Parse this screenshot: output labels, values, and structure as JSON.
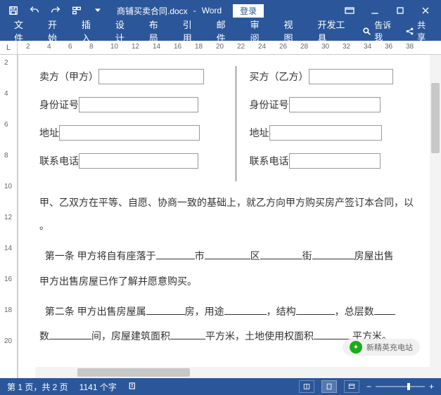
{
  "titlebar": {
    "filename": "商铺买卖合同.docx",
    "sep": "-",
    "app": "Word",
    "login": "登录"
  },
  "ribbon": {
    "tabs": [
      "文件",
      "开始",
      "插入",
      "设计",
      "布局",
      "引用",
      "邮件",
      "审阅",
      "视图",
      "开发工具"
    ],
    "tellme": "告诉我",
    "share": "共享"
  },
  "ruler": {
    "corner": "L",
    "hticks": [
      "2",
      "4",
      "6",
      "8",
      "10",
      "12",
      "14",
      "16",
      "18",
      "20",
      "22",
      "24",
      "26",
      "28",
      "30",
      "32",
      "34",
      "36",
      "38"
    ],
    "vticks": [
      "2",
      "4",
      "6",
      "8",
      "10",
      "12",
      "14",
      "16",
      "18",
      "20"
    ]
  },
  "doc": {
    "seller_title": "卖方（甲方）",
    "buyer_title": "买方（乙方）",
    "id_label": "身份证号",
    "addr_label": "地址",
    "phone_label": "联系电话",
    "para1": "甲、乙双方在平等、自愿、协商一致的基础上，就乙方向甲方购买房产签订本合同，以",
    "para1_cont": "。",
    "art1_head": "第一条",
    "art1_a": "甲方将自有座落于",
    "art1_b": "市",
    "art1_c": "区",
    "art1_d": "街",
    "art1_e": "房屋出售",
    "art1_2": "甲方出售房屋已作了解并愿意购买。",
    "art2_head": "第二条",
    "art2_a": "甲方出售房屋属",
    "art2_b": "房，用途",
    "art2_c": "，结构",
    "art2_d": "，总层数",
    "art2_e": "数",
    "art2_f": "间，房屋建筑面积",
    "art2_g": "平方米，土地使用权面积",
    "art2_h": "平方米。"
  },
  "status": {
    "page": "第 1 页，共 2 页",
    "words": "1141 个字",
    "zoom": "+"
  },
  "watermark": "新精英充电站"
}
